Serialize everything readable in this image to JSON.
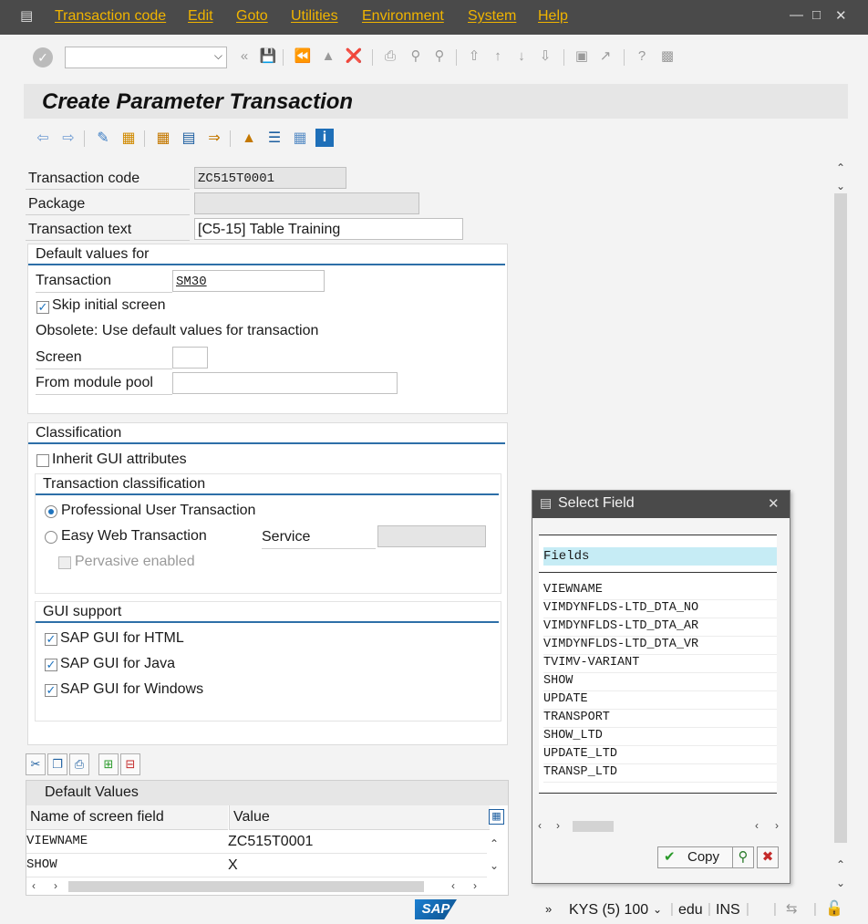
{
  "menu": {
    "items": [
      "Transaction code",
      "Edit",
      "Goto",
      "Utilities",
      "Environment",
      "System",
      "Help"
    ]
  },
  "toolbar": {
    "command_value": ""
  },
  "title": "Create Parameter Transaction",
  "form": {
    "transaction_code_label": "Transaction code",
    "transaction_code_value": "ZC515T0001",
    "package_label": "Package",
    "package_value": "",
    "transaction_text_label": "Transaction text",
    "transaction_text_value": "[C5-15] Table Training"
  },
  "defaults_group": {
    "title": "Default values for",
    "transaction_label": "Transaction",
    "transaction_value": "SM30",
    "skip_initial_label": "Skip initial screen",
    "skip_initial_checked": true,
    "obsolete_text": "Obsolete: Use default values for transaction",
    "screen_label": "Screen",
    "screen_value": "",
    "module_pool_label": "From module pool",
    "module_pool_value": ""
  },
  "classification": {
    "title": "Classification",
    "inherit_label": "Inherit GUI attributes",
    "inherit_checked": false,
    "tx_class_title": "Transaction classification",
    "professional_label": "Professional User Transaction",
    "easy_web_label": "Easy Web Transaction",
    "service_label": "Service",
    "service_value": "",
    "pervasive_label": "Pervasive enabled",
    "gui_title": "GUI support",
    "gui_html_label": "SAP GUI for HTML",
    "gui_java_label": "SAP GUI for Java",
    "gui_windows_label": "SAP GUI for Windows"
  },
  "default_values": {
    "title": "Default Values",
    "col_name": "Name of screen field",
    "col_value": "Value",
    "rows": [
      {
        "name": "VIEWNAME",
        "value": "ZC515T0001"
      },
      {
        "name": "SHOW",
        "value": "X"
      }
    ]
  },
  "popup": {
    "title": "Select Field",
    "column_header": "Fields",
    "fields": [
      "VIEWNAME",
      "VIMDYNFLDS-LTD_DTA_NO",
      "VIMDYNFLDS-LTD_DTA_AR",
      "VIMDYNFLDS-LTD_DTA_VR",
      "TVIMV-VARIANT",
      "SHOW",
      "UPDATE",
      "TRANSPORT",
      "SHOW_LTD",
      "UPDATE_LTD",
      "TRANSP_LTD"
    ],
    "copy_label": "Copy"
  },
  "status": {
    "system": "KYS (5) 100",
    "server": "edu",
    "mode": "INS"
  },
  "colors": {
    "menu_bg": "#4a4a4a",
    "menu_text": "#f0b400",
    "group_line": "#2d6fa8",
    "selection": "#c6ecf5"
  }
}
